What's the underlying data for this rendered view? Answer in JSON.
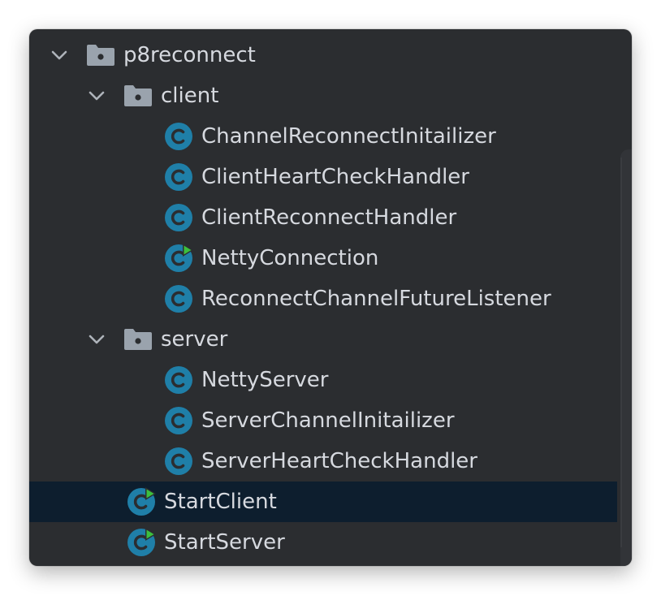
{
  "colors": {
    "panel_bg": "#2b2d30",
    "text": "#d6d9df",
    "selected_bg": "#0d1e2e",
    "folder": "#9aa3ad",
    "class_icon": "#1f7fa8",
    "run_marker": "#3dbf3d"
  },
  "tree": {
    "root": {
      "label": "p8reconnect",
      "icon": "folder-icon",
      "expanded": true
    },
    "client": {
      "label": "client",
      "icon": "folder-icon",
      "expanded": true,
      "items": [
        {
          "label": "ChannelReconnectInitailizer",
          "icon": "class-icon",
          "runnable": false
        },
        {
          "label": "ClientHeartCheckHandler",
          "icon": "class-icon",
          "runnable": false
        },
        {
          "label": "ClientReconnectHandler",
          "icon": "class-icon",
          "runnable": false
        },
        {
          "label": "NettyConnection",
          "icon": "runnable-class-icon",
          "runnable": true
        },
        {
          "label": "ReconnectChannelFutureListener",
          "icon": "class-icon",
          "runnable": false
        }
      ]
    },
    "server": {
      "label": "server",
      "icon": "folder-icon",
      "expanded": true,
      "items": [
        {
          "label": "NettyServer",
          "icon": "class-icon",
          "runnable": false
        },
        {
          "label": "ServerChannelInitailizer",
          "icon": "class-icon",
          "runnable": false
        },
        {
          "label": "ServerHeartCheckHandler",
          "icon": "class-icon",
          "runnable": false
        }
      ]
    },
    "root_items": [
      {
        "label": "StartClient",
        "icon": "runnable-class-icon",
        "runnable": true,
        "selected": true
      },
      {
        "label": "StartServer",
        "icon": "runnable-class-icon",
        "runnable": true,
        "selected": false
      }
    ]
  }
}
